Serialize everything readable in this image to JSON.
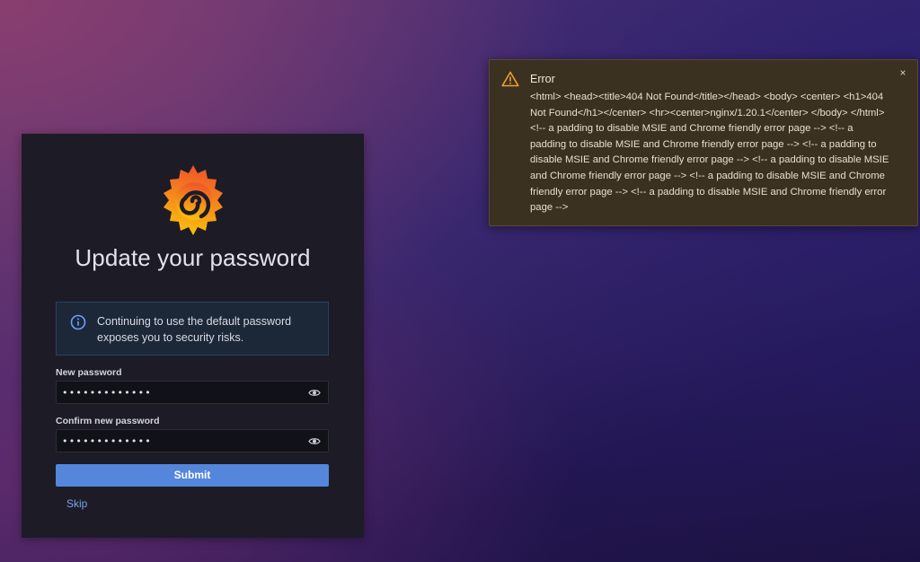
{
  "login": {
    "title": "Update your password",
    "alert_text": "Continuing to use the default password exposes you to security risks.",
    "new_password_label": "New password",
    "new_password_value": "•••••••••••••",
    "confirm_password_label": "Confirm new password",
    "confirm_password_value": "•••••••••••••",
    "submit_label": "Submit",
    "skip_label": "Skip"
  },
  "icons": {
    "logo": "grafana-logo",
    "alert": "info-circle-icon",
    "eye": "eye-icon",
    "warning": "warning-triangle-icon",
    "close": "close-icon"
  },
  "toast": {
    "title": "Error",
    "message": "<html> <head><title>404 Not Found</title></head> <body> <center> <h1>404 Not Found</h1></center> <hr><center>nginx/1.20.1</center> </body> </html> <!-- a padding to disable MSIE and Chrome friendly error page --> <!-- a padding to disable MSIE and Chrome friendly error page --> <!-- a padding to disable MSIE and Chrome friendly error page --> <!-- a padding to disable MSIE and Chrome friendly error page --> <!-- a padding to disable MSIE and Chrome friendly error page --> <!-- a padding to disable MSIE and Chrome friendly error page -->",
    "close_glyph": "×"
  },
  "colors": {
    "accent": "#5486dc",
    "card_bg": "#1d1b26",
    "toast_bg": "#3a3121",
    "warning": "#f0a030",
    "logo_orange": "#f46800",
    "logo_yellow": "#fbca0a"
  }
}
